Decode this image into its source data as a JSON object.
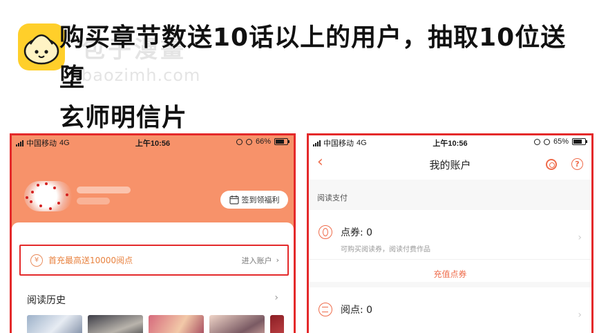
{
  "announcement": {
    "line1": "购买章节数送10话以上的用户，抽取10位送堕",
    "line2": "玄师明信片",
    "watermark_cn": "包子漫畫",
    "watermark_en": "baozimh.com"
  },
  "left_screen": {
    "status": {
      "carrier": "中国移动",
      "network": "4G",
      "time": "上午10:56",
      "battery": "66%",
      "battery_level": 0.66
    },
    "signin_label": "签到领福利",
    "promo": {
      "text": "首充最高送10000阅点",
      "enter_label": "进入账户",
      "icon": "yen-icon"
    },
    "history_title": "阅读历史",
    "history_arrow": "›"
  },
  "right_screen": {
    "status": {
      "carrier": "中国移动",
      "network": "4G",
      "time": "上午10:56",
      "battery": "65%",
      "battery_level": 0.65
    },
    "nav": {
      "back": "‹",
      "title": "我的账户",
      "help": "?"
    },
    "section_label": "阅读支付",
    "coupon": {
      "label": "点券: 0",
      "sub": "可购买阅读券，阅读付费作品"
    },
    "recharge_label": "充值点券",
    "points": {
      "label": "阅点: 0"
    }
  },
  "colors": {
    "frame": "#e4292a",
    "orange": "#f7926a",
    "accent": "#ef6b4a"
  }
}
